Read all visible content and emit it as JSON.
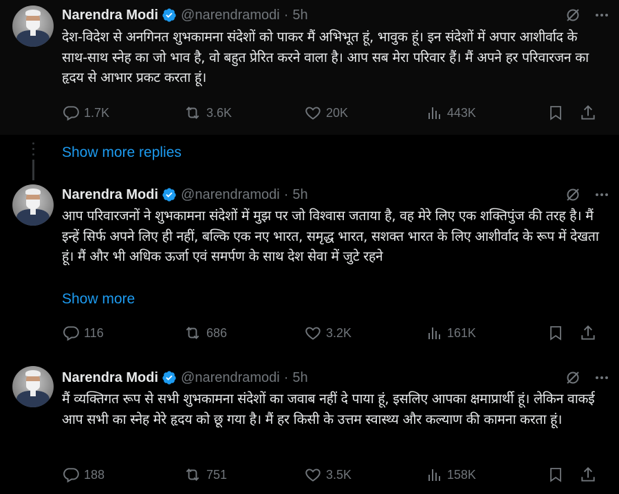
{
  "colors": {
    "background": "#000000",
    "text": "#e7e9ea",
    "muted": "#71767b",
    "link": "#1d9bf0",
    "verified": "#1d9bf0"
  },
  "tweets": [
    {
      "author": "Narendra Modi",
      "handle": "@narendramodi",
      "separator": "·",
      "time": "5h",
      "text": "देश-विदेश से अनगिनत शुभकामना संदेशों को पाकर मैं अभिभूत हूं, भावुक हूं। इन संदेशों में अपार आशीर्वाद के साथ-साथ स्नेह का जो भाव है, वो बहुत प्रेरित करने वाला है। आप सब मेरा परिवार हैं। मैं अपने हर परिवारजन का हृदय से आभार प्रकट करता हूं।",
      "replies": "1.7K",
      "reposts": "3.6K",
      "likes": "20K",
      "views": "443K"
    },
    {
      "author": "Narendra Modi",
      "handle": "@narendramodi",
      "separator": "·",
      "time": "5h",
      "text": "आप परिवारजनों ने शुभकामना संदेशों में मुझ पर जो विश्वास जताया है, वह मेरे लिए एक शक्तिपुंज की तरह है। मैं इन्हें सिर्फ अपने लिए ही नहीं, बल्कि एक नए भारत, समृद्ध भारत, सशक्त भारत के लिए आशीर्वाद के रूप में देखता हूं। मैं और भी अधिक ऊर्जा एवं समर्पण के साथ देश सेवा में जुटे रहने",
      "show_more": "Show more",
      "replies": "116",
      "reposts": "686",
      "likes": "3.2K",
      "views": "161K"
    },
    {
      "author": "Narendra Modi",
      "handle": "@narendramodi",
      "separator": "·",
      "time": "5h",
      "text": "मैं व्यक्तिगत रूप से सभी शुभकामना संदेशों का जवाब नहीं दे पाया हूं, इसलिए आपका क्षमाप्रार्थी हूं। लेकिन वाकई आप सभी का स्नेह मेरे हृदय को छू गया है। मैं हर किसी के उत्तम स्वास्थ्य और कल्याण की कामना करता हूं।",
      "replies": "188",
      "reposts": "751",
      "likes": "3.5K",
      "views": "158K"
    }
  ],
  "show_more_replies": "Show more replies",
  "icons": {
    "verified": "verified-badge-icon",
    "grok": "grok-icon",
    "more": "more-icon",
    "reply": "reply-icon",
    "repost": "repost-icon",
    "like": "like-icon",
    "views": "views-icon",
    "bookmark": "bookmark-icon",
    "share": "share-icon"
  }
}
